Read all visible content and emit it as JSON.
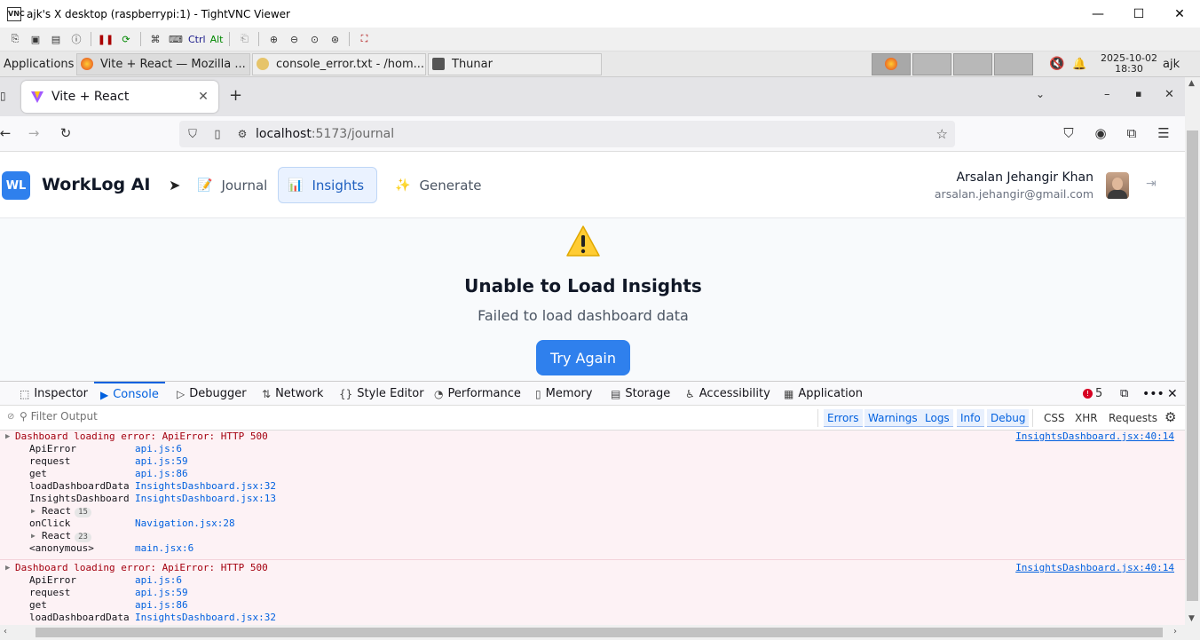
{
  "vnc": {
    "title": "ajk's X desktop (raspberrypi:1) - TightVNC Viewer",
    "app_icon_text": "VNC",
    "minimize": "—",
    "maximize": "☐",
    "close": "✕",
    "toolbar": {
      "ctrl": "Ctrl",
      "alt": "Alt"
    }
  },
  "panel": {
    "applications": "Applications",
    "tasks": [
      {
        "label": "Vite + React — Mozilla ..."
      },
      {
        "label": "console_error.txt - /hom..."
      },
      {
        "label": "Thunar"
      }
    ],
    "date": "2025-10-02",
    "time": "18:30",
    "user": "ajk"
  },
  "browser": {
    "tab_title": "Vite + React",
    "new_tab": "+",
    "url_host": "localhost",
    "url_path": ":5173/journal"
  },
  "app": {
    "logo": "WL",
    "brand": "WorkLog AI",
    "nav": [
      {
        "icon": "📝",
        "label": "Journal"
      },
      {
        "icon": "📊",
        "label": "Insights"
      },
      {
        "icon": "✨",
        "label": "Generate"
      }
    ],
    "user_name": "Arsalan Jehangir Khan",
    "user_email": "arsalan.jehangir@gmail.com",
    "error_title": "Unable to Load Insights",
    "error_message": "Failed to load dashboard data",
    "retry_label": "Try Again"
  },
  "devtools": {
    "tabs": [
      {
        "icon": "⬚",
        "label": "Inspector"
      },
      {
        "icon": "▶",
        "label": "Console"
      },
      {
        "icon": "▷",
        "label": "Debugger"
      },
      {
        "icon": "⇅",
        "label": "Network"
      },
      {
        "icon": "{}",
        "label": "Style Editor"
      },
      {
        "icon": "◔",
        "label": "Performance"
      },
      {
        "icon": "▯",
        "label": "Memory"
      },
      {
        "icon": "▤",
        "label": "Storage"
      },
      {
        "icon": "♿",
        "label": "Accessibility"
      },
      {
        "icon": "▦",
        "label": "Application"
      }
    ],
    "error_count": "5",
    "filter_placeholder": "Filter Output",
    "levels": [
      "Errors",
      "Warnings",
      "Logs",
      "Info",
      "Debug"
    ],
    "types": [
      "CSS",
      "XHR",
      "Requests"
    ],
    "messages": [
      {
        "text": "Dashboard loading error: ApiError: HTTP 500",
        "source": "InsightsDashboard.jsx:40:14",
        "frames": [
          {
            "fn": "ApiError",
            "loc": "api.js:6"
          },
          {
            "fn": "request",
            "loc": "api.js:59"
          },
          {
            "fn": "get",
            "loc": "api.js:86"
          },
          {
            "fn": "loadDashboardData",
            "loc": "InsightsDashboard.jsx:32"
          },
          {
            "fn": "InsightsDashboard",
            "loc": "InsightsDashboard.jsx:13"
          },
          {
            "fn": "React",
            "count": "15"
          },
          {
            "fn": "onClick",
            "loc": "Navigation.jsx:28"
          },
          {
            "fn": "React",
            "count": "23"
          },
          {
            "fn": "<anonymous>",
            "loc": "main.jsx:6"
          }
        ]
      },
      {
        "text": "Dashboard loading error: ApiError: HTTP 500",
        "source": "InsightsDashboard.jsx:40:14",
        "frames": [
          {
            "fn": "ApiError",
            "loc": "api.js:6"
          },
          {
            "fn": "request",
            "loc": "api.js:59"
          },
          {
            "fn": "get",
            "loc": "api.js:86"
          },
          {
            "fn": "loadDashboardData",
            "loc": "InsightsDashboard.jsx:32"
          }
        ]
      }
    ]
  }
}
